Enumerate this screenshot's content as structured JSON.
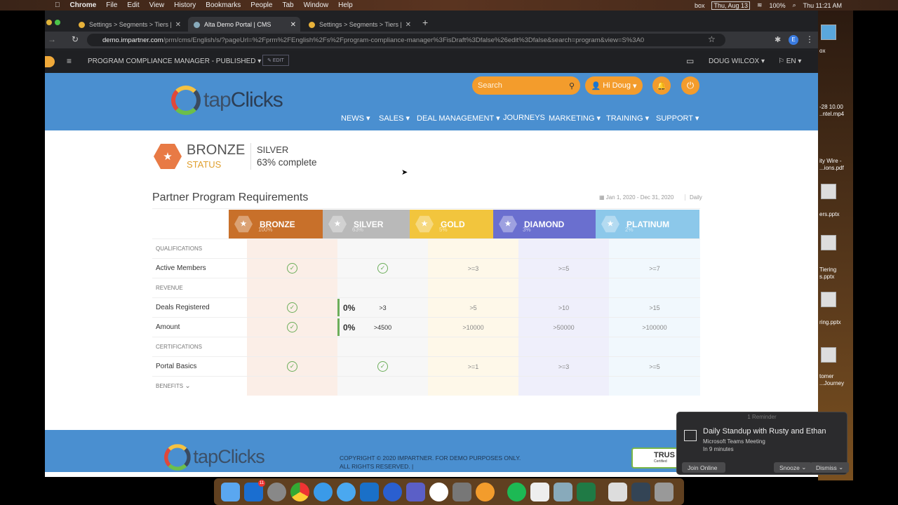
{
  "menubar": {
    "apple": "",
    "app": "Chrome",
    "items": [
      "File",
      "Edit",
      "View",
      "History",
      "Bookmarks",
      "People",
      "Tab",
      "Window",
      "Help"
    ],
    "date_box": "Thu, Aug 13",
    "battery": "100%",
    "clock": "Thu 11:21 AM",
    "box": "box"
  },
  "tabs": [
    {
      "title": "Settings > Segments > Tiers |"
    },
    {
      "title": "Alta Demo Portal | CMS",
      "active": true
    },
    {
      "title": "Settings > Segments > Tiers |"
    }
  ],
  "address": {
    "host": "demo.impartner.com",
    "path": "/prm/cms/English/s/?pageUrl=%2Fprm%2FEnglish%2Fs%2Fprogram-compliance-manager%3FisDraft%3Dfalse%26edit%3Dfalse&search=program&view=S%3A0",
    "profile": "E"
  },
  "cms": {
    "page": "PROGRAM COMPLIANCE MANAGER - PUBLISHED",
    "edit": "EDIT",
    "user": "DOUG WILCOX",
    "lang": "EN"
  },
  "header": {
    "logo_a": "tap",
    "logo_b": "Clicks",
    "search_placeholder": "Search",
    "greeting": "Hi Doug",
    "nav": [
      "NEWS",
      "SALES",
      "DEAL MANAGEMENT",
      "JOURNEYS",
      "MARKETING",
      "TRAINING",
      "SUPPORT"
    ]
  },
  "status": {
    "tier": "BRONZE",
    "label": "STATUS",
    "next": "SILVER",
    "progress": "63% complete",
    "progress_value": 63
  },
  "requirements": {
    "title": "Partner Program Requirements",
    "date_range": "Jan 1, 2020 - Dec 31, 2020",
    "period": "Daily",
    "tiers": [
      {
        "name": "BRONZE",
        "pct": "100%",
        "color": "#c8702a"
      },
      {
        "name": "SILVER",
        "pct": "63%",
        "color": "#b9b9b9"
      },
      {
        "name": "GOLD",
        "pct": "5%",
        "color": "#f2c53d"
      },
      {
        "name": "DIAMOND",
        "pct": "3%",
        "color": "#6a6fcf"
      },
      {
        "name": "PLATINUM",
        "pct": "2%",
        "color": "#8cc8ea"
      }
    ],
    "sections": {
      "qualifications": "QUALIFICATIONS",
      "revenue": "REVENUE",
      "certifications": "CERTIFICATIONS",
      "benefits": "BENEFITS"
    },
    "rows": {
      "active_members": {
        "label": "Active Members",
        "gold": ">=3",
        "diamond": ">=5",
        "platinum": ">=7"
      },
      "deals_registered": {
        "label": "Deals Registered",
        "silver_pct": "0%",
        "silver": ">3",
        "gold": ">5",
        "diamond": ">10",
        "platinum": ">15"
      },
      "amount": {
        "label": "Amount",
        "silver_pct": "0%",
        "silver": ">4500",
        "gold": ">10000",
        "diamond": ">50000",
        "platinum": ">100000"
      },
      "portal_basics": {
        "label": "Portal Basics",
        "gold": ">=1",
        "diamond": ">=3",
        "platinum": ">=5"
      }
    }
  },
  "footer": {
    "copyright": "COPYRIGHT © 2020 IMPARTNER. FOR DEMO PURPOSES ONLY.",
    "rights": "ALL RIGHTS RESERVED. |",
    "trust": "TRUS",
    "trust_sub": "Certified"
  },
  "reminder": {
    "header": "1 Reminder",
    "title": "Daily Standup with Rusty and Ethan",
    "subtitle": "Microsoft Teams Meeting",
    "when": "In 9 minutes",
    "join": "Join Online",
    "snooze": "Snooze",
    "dismiss": "Dismiss"
  },
  "desktop_files": [
    "ox",
    "-28 10.00",
    "..ntel.mp4",
    "ity Wire -",
    "...ions.pdf",
    "ers.pptx",
    "Tiering",
    "s.pptx",
    "ring.pptx",
    "tomer",
    "...Journey"
  ],
  "dock": {
    "outlook_badge": "11"
  }
}
